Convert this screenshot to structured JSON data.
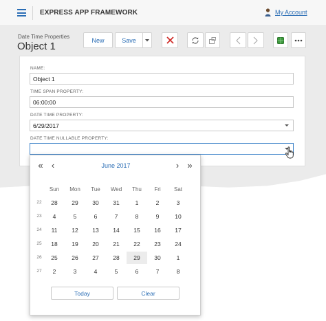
{
  "app": {
    "title": "EXPRESS APP FRAMEWORK",
    "account_link": "My Account"
  },
  "header": {
    "breadcrumb": "Date Time Properties",
    "object_title": "Object 1"
  },
  "toolbar": {
    "new_label": "New",
    "save_label": "Save"
  },
  "form": {
    "name_label": "NAME:",
    "name_value": "Object 1",
    "timespan_label": "TIME SPAN PROPERTY:",
    "timespan_value": "06:00:00",
    "datetime_label": "DATE TIME PROPERTY:",
    "datetime_value": "6/29/2017",
    "nullable_label": "DATE TIME NULLABLE PROPERTY:",
    "nullable_value": ""
  },
  "calendar": {
    "month_label": "June 2017",
    "days_of_week": [
      "Sun",
      "Mon",
      "Tue",
      "Wed",
      "Thu",
      "Fri",
      "Sat"
    ],
    "weeks": [
      {
        "num": "22",
        "days": [
          "28",
          "29",
          "30",
          "31",
          "1",
          "2",
          "3"
        ]
      },
      {
        "num": "23",
        "days": [
          "4",
          "5",
          "6",
          "7",
          "8",
          "9",
          "10"
        ]
      },
      {
        "num": "24",
        "days": [
          "11",
          "12",
          "13",
          "14",
          "15",
          "16",
          "17"
        ]
      },
      {
        "num": "25",
        "days": [
          "18",
          "19",
          "20",
          "21",
          "22",
          "23",
          "24"
        ]
      },
      {
        "num": "26",
        "days": [
          "25",
          "26",
          "27",
          "28",
          "29",
          "30",
          "1"
        ]
      },
      {
        "num": "27",
        "days": [
          "2",
          "3",
          "4",
          "5",
          "6",
          "7",
          "8"
        ]
      }
    ],
    "highlighted_day": "29",
    "today_label": "Today",
    "clear_label": "Clear"
  },
  "colors": {
    "accent": "#2a6db5",
    "delete_red": "#d0312d",
    "green": "#3e9a3e"
  },
  "icons": [
    "hamburger-icon",
    "user-icon",
    "close-icon",
    "refresh-icon",
    "link-icon",
    "chevron-left-icon",
    "chevron-right-icon",
    "grid-icon",
    "more-icon",
    "first-icon",
    "prev-icon",
    "next-icon",
    "last-icon"
  ]
}
